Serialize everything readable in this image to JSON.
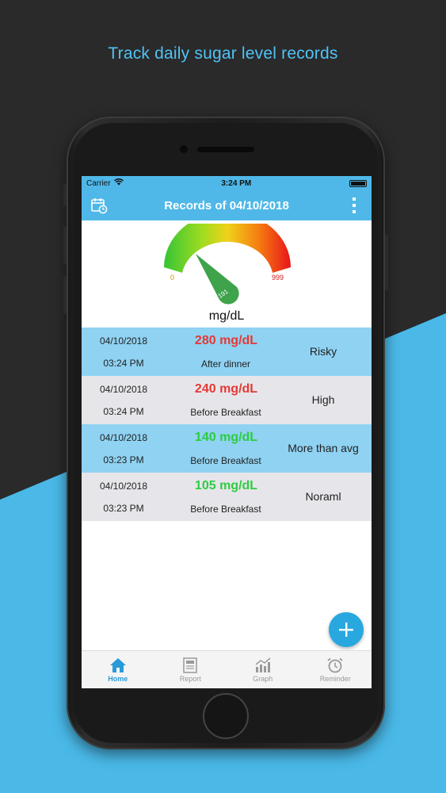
{
  "headline": "Track daily sugar level records",
  "colors": {
    "accent": "#4fb8e8",
    "risky": "#e53935",
    "normal": "#2ecc40",
    "row_blue": "#8fd2f2",
    "row_gray": "#e6e6ea"
  },
  "status_bar": {
    "carrier": "Carrier",
    "time": "3:24 PM"
  },
  "app_bar": {
    "title": "Records of 04/10/2018",
    "left_icon": "calendar-clock-icon",
    "right_icon": "more-vertical-icon"
  },
  "gauge": {
    "min_label": "0",
    "max_label": "999",
    "value": "191",
    "unit": "mg/dL"
  },
  "records": [
    {
      "date": "04/10/2018",
      "time": "03:24 PM",
      "value": "280 mg/dL",
      "meal": "After dinner",
      "status": "Risky",
      "color": "#e53935"
    },
    {
      "date": "04/10/2018",
      "time": "03:24 PM",
      "value": "240 mg/dL",
      "meal": "Before Breakfast",
      "status": "High",
      "color": "#e53935"
    },
    {
      "date": "04/10/2018",
      "time": "03:23 PM",
      "value": "140 mg/dL",
      "meal": "Before Breakfast",
      "status": "More than avg",
      "color": "#2ecc40"
    },
    {
      "date": "04/10/2018",
      "time": "03:23 PM",
      "value": "105 mg/dL",
      "meal": "Before Breakfast",
      "status": "Noraml",
      "color": "#2ecc40"
    }
  ],
  "tabs": [
    {
      "label": "Home",
      "icon": "home-icon"
    },
    {
      "label": "Report",
      "icon": "report-icon"
    },
    {
      "label": "Graph",
      "icon": "graph-icon"
    },
    {
      "label": "Reminder",
      "icon": "alarm-clock-icon"
    }
  ]
}
